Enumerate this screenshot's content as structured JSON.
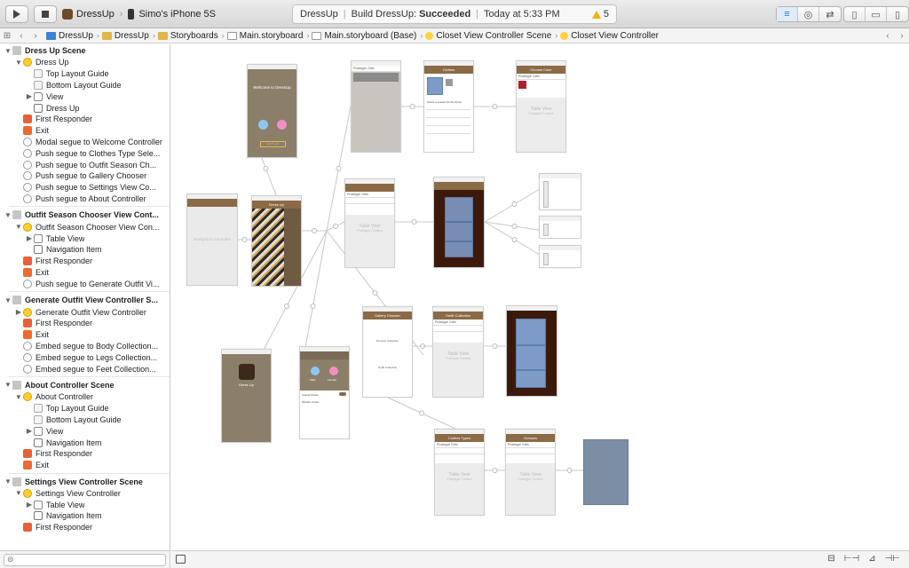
{
  "toolbar": {
    "scheme": "DressUp",
    "device": "Simo's iPhone 5S",
    "status": {
      "project": "DressUp",
      "build_prefix": "Build DressUp:",
      "build_result": "Succeeded",
      "time": "Today at 5:33 PM",
      "warnings": "5"
    }
  },
  "jumpbar": {
    "crumbs": [
      "DressUp",
      "DressUp",
      "Storyboards",
      "Main.storyboard",
      "Main.storyboard (Base)",
      "Closet View Controller Scene",
      "Closet View Controller"
    ]
  },
  "outline": {
    "rows": [
      {
        "level": 0,
        "tri": "▼",
        "icon": "scene",
        "label": "Dress Up Scene",
        "scene": true
      },
      {
        "level": 1,
        "tri": "▼",
        "icon": "vc",
        "label": "Dress Up"
      },
      {
        "level": 2,
        "tri": "",
        "icon": "guide",
        "label": "Top Layout Guide"
      },
      {
        "level": 2,
        "tri": "",
        "icon": "guide",
        "label": "Bottom Layout Guide"
      },
      {
        "level": 2,
        "tri": "▶",
        "icon": "view",
        "label": "View"
      },
      {
        "level": 2,
        "tri": "",
        "icon": "nav",
        "label": "Dress Up"
      },
      {
        "level": 1,
        "tri": "",
        "icon": "fr",
        "label": "First Responder"
      },
      {
        "level": 1,
        "tri": "",
        "icon": "exit",
        "label": "Exit"
      },
      {
        "level": 1,
        "tri": "",
        "icon": "segue",
        "label": "Modal segue to Welcome Controller"
      },
      {
        "level": 1,
        "tri": "",
        "icon": "segue",
        "label": "Push segue to Clothes Type Sele..."
      },
      {
        "level": 1,
        "tri": "",
        "icon": "segue",
        "label": "Push segue to Outfit Season Ch..."
      },
      {
        "level": 1,
        "tri": "",
        "icon": "segue",
        "label": "Push segue to Gallery Chooser"
      },
      {
        "level": 1,
        "tri": "",
        "icon": "segue",
        "label": "Push segue to Settings View Co..."
      },
      {
        "level": 1,
        "tri": "",
        "icon": "segue",
        "label": "Push segue to About Controller"
      },
      {
        "sep": true
      },
      {
        "level": 0,
        "tri": "▼",
        "icon": "scene",
        "label": "Outfit Season Chooser View Cont...",
        "scene": true
      },
      {
        "level": 1,
        "tri": "▼",
        "icon": "vc",
        "label": "Outfit Season Chooser View Con..."
      },
      {
        "level": 2,
        "tri": "▶",
        "icon": "view",
        "label": "Table View"
      },
      {
        "level": 2,
        "tri": "",
        "icon": "nav",
        "label": "Navigation Item"
      },
      {
        "level": 1,
        "tri": "",
        "icon": "fr",
        "label": "First Responder"
      },
      {
        "level": 1,
        "tri": "",
        "icon": "exit",
        "label": "Exit"
      },
      {
        "level": 1,
        "tri": "",
        "icon": "segue",
        "label": "Push segue to Generate Outfit Vi..."
      },
      {
        "sep": true
      },
      {
        "level": 0,
        "tri": "▼",
        "icon": "scene",
        "label": "Generate Outfit View Controller S...",
        "scene": true
      },
      {
        "level": 1,
        "tri": "▶",
        "icon": "vc",
        "label": "Generate Outfit View Controller"
      },
      {
        "level": 1,
        "tri": "",
        "icon": "fr",
        "label": "First Responder"
      },
      {
        "level": 1,
        "tri": "",
        "icon": "exit",
        "label": "Exit"
      },
      {
        "level": 1,
        "tri": "",
        "icon": "segue",
        "label": "Embed segue to Body Collection..."
      },
      {
        "level": 1,
        "tri": "",
        "icon": "segue",
        "label": "Embed segue to Legs Collection..."
      },
      {
        "level": 1,
        "tri": "",
        "icon": "segue",
        "label": "Embed segue to Feet Collection..."
      },
      {
        "sep": true
      },
      {
        "level": 0,
        "tri": "▼",
        "icon": "scene",
        "label": "About Controller Scene",
        "scene": true
      },
      {
        "level": 1,
        "tri": "▼",
        "icon": "vc",
        "label": "About Controller"
      },
      {
        "level": 2,
        "tri": "",
        "icon": "guide",
        "label": "Top Layout Guide"
      },
      {
        "level": 2,
        "tri": "",
        "icon": "guide",
        "label": "Bottom Layout Guide"
      },
      {
        "level": 2,
        "tri": "▶",
        "icon": "view",
        "label": "View"
      },
      {
        "level": 2,
        "tri": "",
        "icon": "nav",
        "label": "Navigation Item"
      },
      {
        "level": 1,
        "tri": "",
        "icon": "fr",
        "label": "First Responder"
      },
      {
        "level": 1,
        "tri": "",
        "icon": "exit",
        "label": "Exit"
      },
      {
        "sep": true
      },
      {
        "level": 0,
        "tri": "▼",
        "icon": "scene",
        "label": "Settings View Controller Scene",
        "scene": true
      },
      {
        "level": 1,
        "tri": "▼",
        "icon": "vc",
        "label": "Settings View Controller"
      },
      {
        "level": 2,
        "tri": "▶",
        "icon": "view",
        "label": "Table View"
      },
      {
        "level": 2,
        "tri": "",
        "icon": "nav",
        "label": "Navigation Item"
      },
      {
        "level": 1,
        "tri": "",
        "icon": "fr",
        "label": "First Responder"
      }
    ]
  },
  "canvas": {
    "screens": [
      {
        "id": "welcome",
        "type": "welcome",
        "heading": "Welcome to DressUp",
        "button": "LET'S GO"
      },
      {
        "id": "nav",
        "type": "nav",
        "label": "Navigation Controller"
      },
      {
        "id": "dressup",
        "type": "dressup",
        "nav": "Dress Up"
      },
      {
        "id": "closet",
        "type": "closet",
        "cell": "Prototype Cells"
      },
      {
        "id": "clothes-type",
        "type": "clothes",
        "nav": "Clothes",
        "prompt": "Select a season for the dress"
      },
      {
        "id": "color",
        "type": "table",
        "nav": "Choose Color",
        "cell": "Prototype Cells",
        "tv": "Table View",
        "tvsub": "Prototype Content"
      },
      {
        "id": "season",
        "type": "table",
        "nav": "",
        "cell": "Prototype Cells",
        "tv": "Table View",
        "tvsub": "Prototype Content"
      },
      {
        "id": "generate",
        "type": "generate"
      },
      {
        "id": "about",
        "type": "about",
        "name": "Dress Up"
      },
      {
        "id": "settings",
        "type": "settings",
        "left": "Male",
        "right": "Female",
        "row1": "Casual Closet",
        "row2": "Modern Closet"
      },
      {
        "id": "gallery",
        "type": "gallery",
        "nav": "Gallery Chooser",
        "item1": "Dresses Collection",
        "item2": "Outfit Collection"
      },
      {
        "id": "outfit-collection",
        "type": "table",
        "nav": "Outfit Collection",
        "cell": "Prototype Cells",
        "tv": "Table View",
        "tvsub": "Prototype Content"
      },
      {
        "id": "photo-grid",
        "type": "photo"
      },
      {
        "id": "clothes-types",
        "type": "table",
        "nav": "Clothes Types",
        "cell": "Prototype Cells",
        "tv": "Table View",
        "tvsub": "Prototype Content"
      },
      {
        "id": "dresses",
        "type": "table",
        "nav": "Dresses",
        "cell": "Prototype Cells",
        "tv": "Table View",
        "tvsub": "Prototype Content"
      },
      {
        "id": "image-view",
        "type": "image"
      }
    ]
  }
}
